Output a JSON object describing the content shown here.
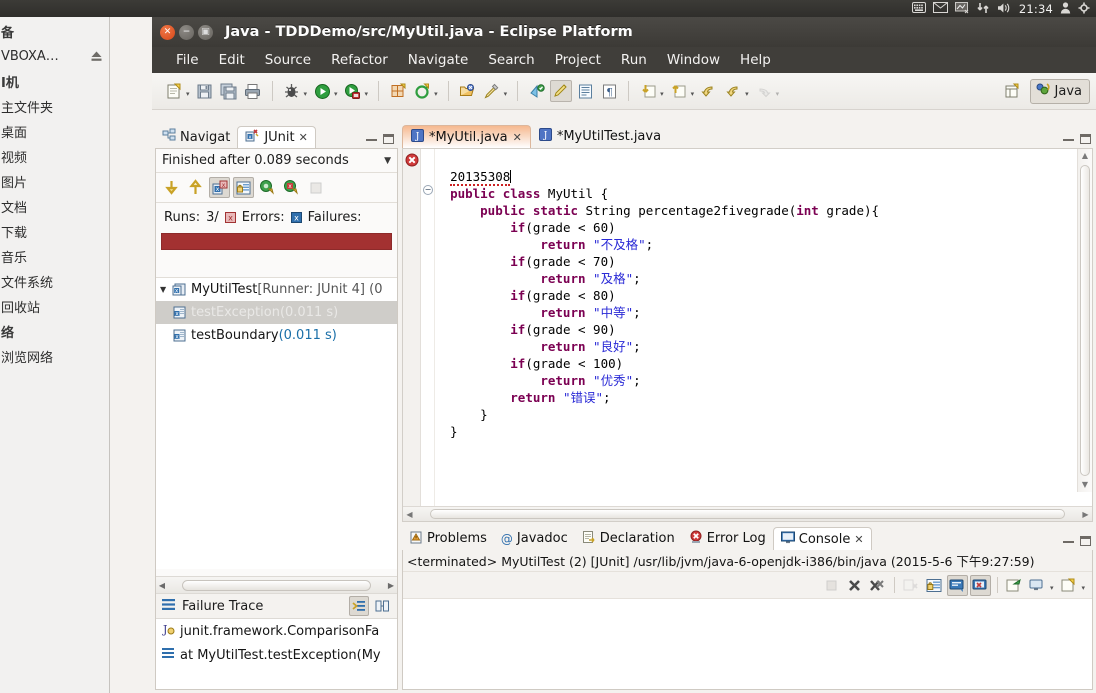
{
  "unity_panel": {
    "indicators": [
      "keyboard-icon",
      "mail-icon",
      "display-icon",
      "network-icon",
      "volume-icon"
    ],
    "clock": "21:34",
    "user_icon": "user-icon",
    "gear_icon": "gear-icon"
  },
  "file_manager": {
    "items": [
      {
        "label": "备",
        "type": "header",
        "clipped": true
      },
      {
        "label": "VBOXA…",
        "type": "device",
        "eject": true
      },
      {
        "label": "I机",
        "type": "header",
        "clipped": true
      },
      {
        "label": "主文件夹",
        "type": "place"
      },
      {
        "label": "桌面",
        "type": "place"
      },
      {
        "label": "视频",
        "type": "place"
      },
      {
        "label": "图片",
        "type": "place"
      },
      {
        "label": "文档",
        "type": "place"
      },
      {
        "label": "下载",
        "type": "place"
      },
      {
        "label": "音乐",
        "type": "place"
      },
      {
        "label": "文件系统",
        "type": "place"
      },
      {
        "label": "回收站",
        "type": "place"
      },
      {
        "label": "络",
        "type": "header",
        "clipped": true
      },
      {
        "label": "浏览网络",
        "type": "place"
      }
    ]
  },
  "eclipse": {
    "title": "Java - TDDDemo/src/MyUtil.java - Eclipse Platform",
    "window_buttons": {
      "close": "close-icon",
      "minimize": "minimize-icon",
      "maximize": "maximize-icon"
    },
    "menu": [
      "File",
      "Edit",
      "Source",
      "Refactor",
      "Navigate",
      "Search",
      "Project",
      "Run",
      "Window",
      "Help"
    ],
    "toolbar_groups": [
      [
        "new-icon",
        "save-icon",
        "save-all-icon",
        "print-icon"
      ],
      [
        "debug-icon",
        "run-icon",
        "coverage-icon"
      ],
      [
        "new-java-package-icon",
        "new-java-class-icon"
      ],
      [
        "open-type-icon",
        "search-icon"
      ],
      [
        "next-annotation-icon",
        "toggle-mark-occurrences-icon",
        "show-whitespace-icon",
        "pilcrow-icon"
      ],
      [
        "next-edit-position-icon",
        "previous-edit-position-icon",
        "back-icon",
        "forward-icon",
        "redo-nav-icon"
      ]
    ],
    "perspective": {
      "open_icon": "open-perspective-icon",
      "current": "Java",
      "current_icon": "java-perspective-icon"
    }
  },
  "junit_view": {
    "tabs": [
      {
        "label": "Navigat",
        "icon": "navigator-icon",
        "active": false
      },
      {
        "label": "JUnit",
        "icon": "junit-icon",
        "active": true,
        "closable": true
      }
    ],
    "status": "Finished after 0.089 seconds",
    "menu_icon": "view-menu-icon",
    "toolbar": [
      {
        "name": "next-failure-icon",
        "pressed": false
      },
      {
        "name": "previous-failure-icon",
        "pressed": false
      },
      {
        "name": "show-failures-only-icon",
        "pressed": true
      },
      {
        "name": "scroll-lock-icon",
        "pressed": true
      },
      {
        "name": "rerun-test-icon",
        "pressed": false
      },
      {
        "name": "rerun-failed-tests-icon",
        "pressed": false
      },
      {
        "name": "stop-icon",
        "pressed": false,
        "disabled": true
      }
    ],
    "counts": {
      "runs_label": "Runs:",
      "runs_value": "3/",
      "errors_label": "Errors:",
      "failures_label": "Failures:",
      "bar_color": "#a33131"
    },
    "tree": [
      {
        "label": "MyUtilTest",
        "suffix": " [Runner: JUnit 4] (0",
        "icon": "test-suite-icon",
        "expanded": true,
        "selected": false,
        "depth": 0
      },
      {
        "label": "testException",
        "time": " (0.011 s)",
        "icon": "test-case-icon",
        "selected": true,
        "depth": 1
      },
      {
        "label": "testBoundary",
        "time": " (0.011 s)",
        "icon": "test-case-icon",
        "selected": false,
        "depth": 1
      }
    ],
    "failure_trace": {
      "title": "Failure Trace",
      "icon": "stack-trace-icon",
      "buttons": [
        {
          "name": "filter-stack-trace-icon",
          "pressed": true
        },
        {
          "name": "compare-result-icon",
          "pressed": false
        }
      ],
      "entries": [
        {
          "icon": "exception-icon",
          "text": "junit.framework.ComparisonFa"
        },
        {
          "icon": "stack-frame-icon",
          "text": "at MyUtilTest.testException(My"
        }
      ]
    }
  },
  "editor": {
    "tabs": [
      {
        "label": "*MyUtil.java",
        "icon": "java-file-icon",
        "active": true,
        "closable": true
      },
      {
        "label": "*MyUtilTest.java",
        "icon": "java-file-icon",
        "active": false,
        "closable": false
      }
    ],
    "error_marker": "error-marker-icon",
    "fold_marker": "collapse-icon",
    "code_lines": [
      {
        "indent": 0,
        "tokens": [
          {
            "t": "20135308",
            "c": "err"
          }
        ],
        "caret": true
      },
      {
        "indent": 0,
        "tokens": [
          {
            "t": "public",
            "c": "kw"
          },
          {
            "t": " "
          },
          {
            "t": "class",
            "c": "kw"
          },
          {
            "t": " MyUtil {"
          }
        ]
      },
      {
        "indent": 1,
        "tokens": [
          {
            "t": "public",
            "c": "kw"
          },
          {
            "t": " "
          },
          {
            "t": "static",
            "c": "kw"
          },
          {
            "t": " String percentage2fivegrade("
          },
          {
            "t": "int",
            "c": "kw"
          },
          {
            "t": " grade){"
          }
        ]
      },
      {
        "indent": 2,
        "tokens": [
          {
            "t": "if",
            "c": "kw"
          },
          {
            "t": "(grade < 60)"
          }
        ]
      },
      {
        "indent": 3,
        "tokens": [
          {
            "t": "return",
            "c": "kw"
          },
          {
            "t": " "
          },
          {
            "t": "\"不及格\"",
            "c": "str"
          },
          {
            "t": ";"
          }
        ]
      },
      {
        "indent": 2,
        "tokens": [
          {
            "t": "if",
            "c": "kw"
          },
          {
            "t": "(grade < 70)"
          }
        ]
      },
      {
        "indent": 3,
        "tokens": [
          {
            "t": "return",
            "c": "kw"
          },
          {
            "t": " "
          },
          {
            "t": "\"及格\"",
            "c": "str"
          },
          {
            "t": ";"
          }
        ]
      },
      {
        "indent": 2,
        "tokens": [
          {
            "t": "if",
            "c": "kw"
          },
          {
            "t": "(grade < 80)"
          }
        ]
      },
      {
        "indent": 3,
        "tokens": [
          {
            "t": "return",
            "c": "kw"
          },
          {
            "t": " "
          },
          {
            "t": "\"中等\"",
            "c": "str"
          },
          {
            "t": ";"
          }
        ]
      },
      {
        "indent": 2,
        "tokens": [
          {
            "t": "if",
            "c": "kw"
          },
          {
            "t": "(grade < 90)"
          }
        ]
      },
      {
        "indent": 3,
        "tokens": [
          {
            "t": "return",
            "c": "kw"
          },
          {
            "t": " "
          },
          {
            "t": "\"良好\"",
            "c": "str"
          },
          {
            "t": ";"
          }
        ]
      },
      {
        "indent": 2,
        "tokens": [
          {
            "t": "if",
            "c": "kw"
          },
          {
            "t": "(grade < 100)"
          }
        ]
      },
      {
        "indent": 3,
        "tokens": [
          {
            "t": "return",
            "c": "kw"
          },
          {
            "t": " "
          },
          {
            "t": "\"优秀\"",
            "c": "str"
          },
          {
            "t": ";"
          }
        ]
      },
      {
        "indent": 2,
        "tokens": [
          {
            "t": "return",
            "c": "kw"
          },
          {
            "t": " "
          },
          {
            "t": "\"错误\"",
            "c": "str"
          },
          {
            "t": ";"
          }
        ]
      },
      {
        "indent": 1,
        "tokens": [
          {
            "t": "}"
          }
        ]
      },
      {
        "indent": 0,
        "tokens": [
          {
            "t": "}"
          }
        ]
      }
    ]
  },
  "bottom_view": {
    "tabs": [
      {
        "label": "Problems",
        "icon": "problems-icon",
        "active": false
      },
      {
        "label": "Javadoc",
        "icon": "javadoc-icon",
        "active": false
      },
      {
        "label": "Declaration",
        "icon": "declaration-icon",
        "active": false
      },
      {
        "label": "Error Log",
        "icon": "error-log-icon",
        "active": false
      },
      {
        "label": "Console",
        "icon": "console-icon",
        "active": true,
        "closable": true
      }
    ],
    "console_header": "<terminated> MyUtilTest (2) [JUnit] /usr/lib/jvm/java-6-openjdk-i386/bin/java (2015-5-6 下午9:27:59)",
    "toolbar": [
      {
        "name": "terminate-icon",
        "pressed": false,
        "disabled": true
      },
      {
        "name": "remove-launch-icon",
        "pressed": false
      },
      {
        "name": "remove-all-terminated-icon",
        "pressed": false
      },
      {
        "name": "clear-console-icon",
        "pressed": false,
        "disabled": true
      },
      {
        "name": "scroll-lock-icon",
        "pressed": false
      },
      {
        "name": "pin-console-icon",
        "pressed": true
      },
      {
        "name": "display-selected-console-icon",
        "pressed": true
      },
      {
        "name": "open-console-icon",
        "pressed": false
      },
      {
        "name": "new-console-view-icon",
        "pressed": false
      },
      {
        "name": "console-options-icon",
        "pressed": false
      }
    ]
  }
}
